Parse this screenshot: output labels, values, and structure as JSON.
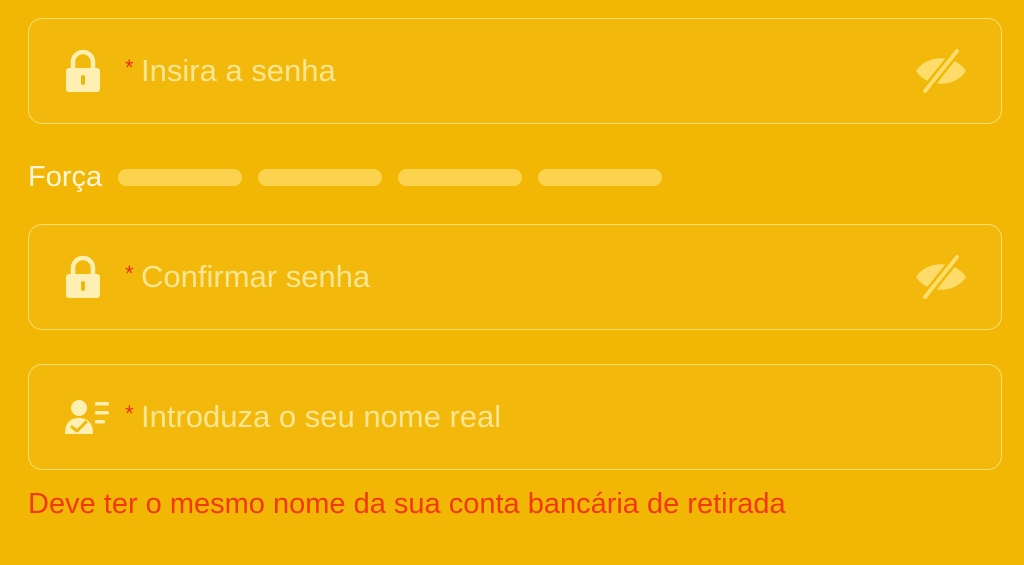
{
  "password": {
    "required_mark": "*",
    "placeholder": "Insira a senha",
    "icon": "lock-icon",
    "toggle_icon": "eye-off-icon"
  },
  "strength": {
    "label": "Força",
    "level": 0,
    "segments": 4
  },
  "confirm_password": {
    "required_mark": "*",
    "placeholder": "Confirmar senha",
    "icon": "lock-icon",
    "toggle_icon": "eye-off-icon"
  },
  "real_name": {
    "required_mark": "*",
    "placeholder": "Introduza o seu nome real",
    "icon": "id-card-icon"
  },
  "hint": {
    "text": "Deve ter o mesmo nome da sua conta bancária de retirada"
  },
  "colors": {
    "background": "#F2B705",
    "required": "#E8321A",
    "hint": "#F2380F"
  }
}
